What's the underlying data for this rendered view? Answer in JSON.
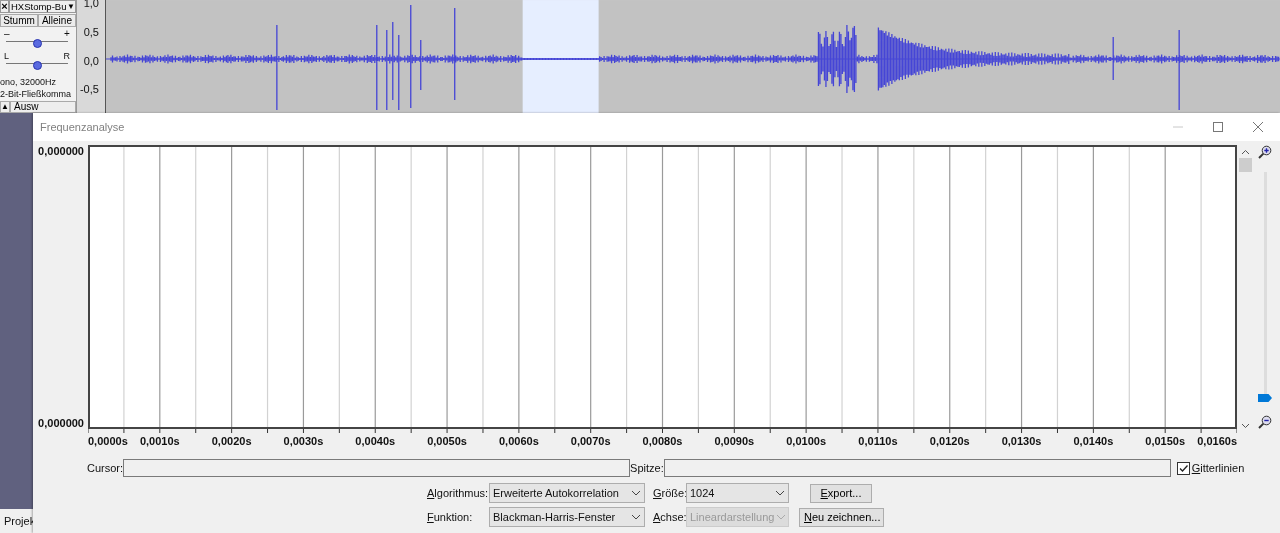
{
  "track": {
    "close": "×",
    "name": "HXStomp-Bu",
    "menu_arrow": "▼",
    "buttons": [
      {
        "label": "Stumm"
      },
      {
        "label": "Alleine"
      }
    ],
    "gain": {
      "minus": "–",
      "plus": "+",
      "level": 0.5
    },
    "pan": {
      "left": "L",
      "right": "R",
      "level": 0.5
    },
    "info": [
      "ono, 32000Hz",
      "2-Bit-Fließkomma"
    ],
    "collapse": "▲",
    "select_button": "Ausw"
  },
  "scale_labels": [
    "1,0",
    "0,5",
    "0,0",
    "-0,5"
  ],
  "footer_tab": "Projek",
  "dialog": {
    "title": "Frequenzanalyse",
    "plot": {
      "y_labels": [
        "0,000000",
        "0,000000"
      ],
      "x_labels": [
        "0,0000s",
        "0,0010s",
        "0,0020s",
        "0,0030s",
        "0,0040s",
        "0,0050s",
        "0,0060s",
        "0,0070s",
        "0,0080s",
        "0,0090s",
        "0,0100s",
        "0,0110s",
        "0,0120s",
        "0,0130s",
        "0,0140s",
        "0,0150s",
        "0,0160s"
      ]
    },
    "zoom": {
      "level": 0
    },
    "cursor": {
      "label": "Cursor:"
    },
    "peak": {
      "label": "Spitze:"
    },
    "gridlines": {
      "label": "Gitterlinien",
      "checked": true
    },
    "algorithm": {
      "label": "Algorithmus:",
      "value": "Erweiterte Autokorrelation",
      "disabled": false
    },
    "size": {
      "label": "Größe:",
      "value": "1024",
      "disabled": false
    },
    "function": {
      "label": "Funktion:",
      "value": "Blackman-Harris-Fenster",
      "disabled": false
    },
    "axis": {
      "label": "Achse:",
      "value": "Lineardarstellung",
      "disabled": true
    },
    "buttons": [
      {
        "label": "Export..."
      },
      {
        "label": "Neu zeichnen..."
      }
    ]
  }
}
